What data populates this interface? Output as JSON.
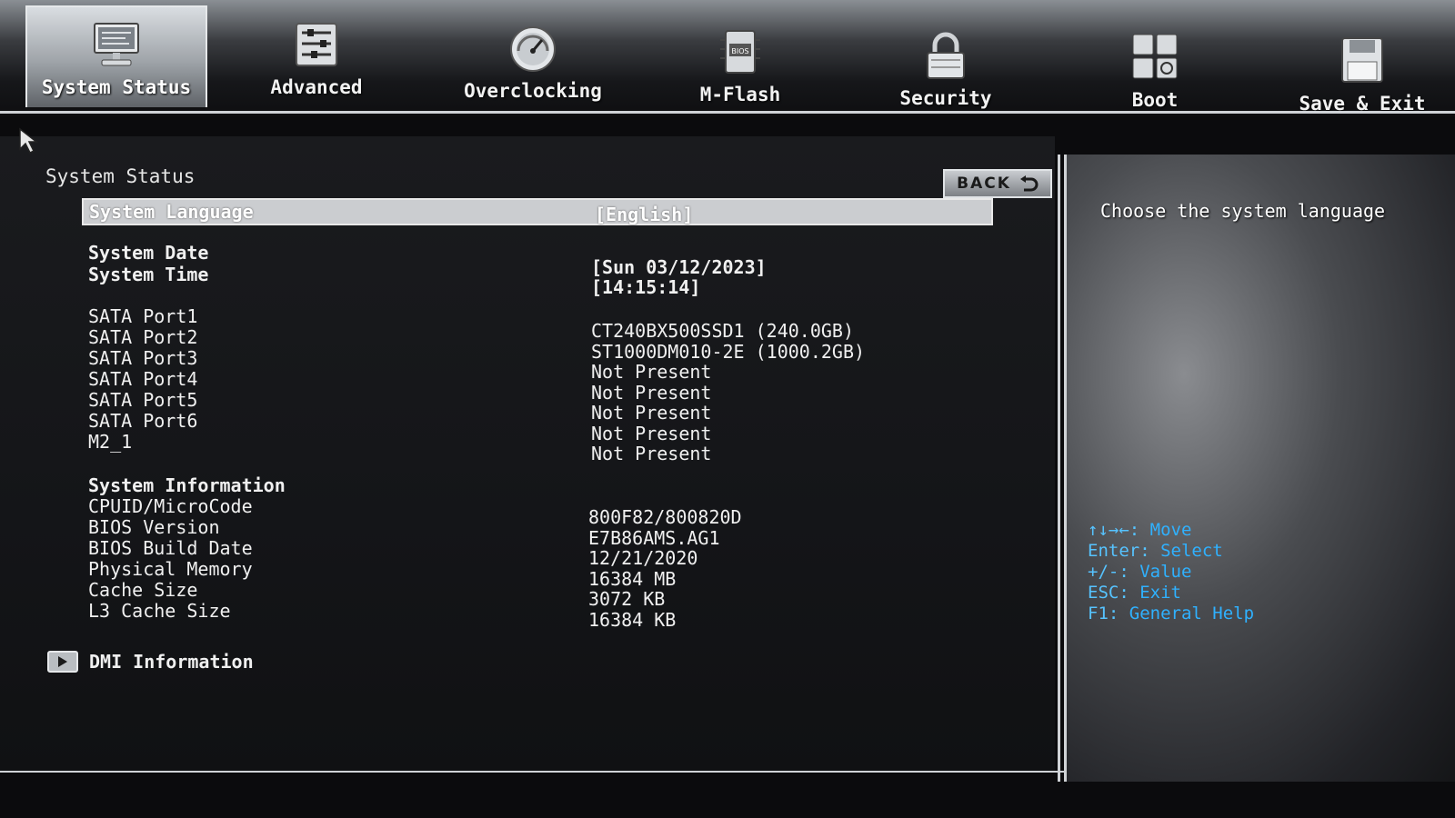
{
  "tabs": [
    {
      "label": "System Status",
      "icon": "monitor-icon",
      "active": true
    },
    {
      "label": "Advanced",
      "icon": "sliders-icon",
      "active": false
    },
    {
      "label": "Overclocking",
      "icon": "gauge-icon",
      "active": false
    },
    {
      "label": "M-Flash",
      "icon": "chip-icon",
      "active": false
    },
    {
      "label": "Security",
      "icon": "lock-icon",
      "active": false
    },
    {
      "label": "Boot",
      "icon": "boot-grid-icon",
      "active": false
    },
    {
      "label": "Save & Exit",
      "icon": "floppy-disk-icon",
      "active": false
    }
  ],
  "main": {
    "title": "System Status",
    "back_label": "BACK",
    "language": {
      "label": "System Language",
      "value": "[English]"
    },
    "date": {
      "label": "System Date",
      "value": "[Sun 03/12/2023]"
    },
    "time": {
      "label": "System Time",
      "value": "[14:15:14]"
    },
    "sata": [
      {
        "label": "SATA Port1",
        "value": "CT240BX500SSD1 (240.0GB)"
      },
      {
        "label": "SATA Port2",
        "value": "ST1000DM010-2E (1000.2GB)"
      },
      {
        "label": "SATA Port3",
        "value": "Not Present"
      },
      {
        "label": "SATA Port4",
        "value": "Not Present"
      },
      {
        "label": "SATA Port5",
        "value": "Not Present"
      },
      {
        "label": "SATA Port6",
        "value": "Not Present"
      },
      {
        "label": "M2_1",
        "value": "Not Present"
      }
    ],
    "sysinfo_heading": "System Information",
    "sysinfo": [
      {
        "label": "CPUID/MicroCode",
        "value": "800F82/800820D"
      },
      {
        "label": "BIOS Version",
        "value": "E7B86AMS.AG1"
      },
      {
        "label": "BIOS Build Date",
        "value": "12/21/2020"
      },
      {
        "label": "Physical Memory",
        "value": "16384 MB"
      },
      {
        "label": "Cache Size",
        "value": "3072 KB"
      },
      {
        "label": "L3 Cache Size",
        "value": "16384 KB"
      }
    ],
    "dmi_label": "DMI Information"
  },
  "help": {
    "description": "Choose the system language",
    "keys": [
      {
        "key": "↑↓→←:",
        "action": "Move"
      },
      {
        "key": "Enter:",
        "action": "Select"
      },
      {
        "key": "+/-:",
        "action": "Value"
      },
      {
        "key": "ESC:",
        "action": "Exit"
      },
      {
        "key": "F1:",
        "action": "General Help"
      }
    ]
  },
  "colors": {
    "accent_blue": "#2fb1ff",
    "highlight_bar": "#cbcdd0",
    "background": "#141518"
  }
}
